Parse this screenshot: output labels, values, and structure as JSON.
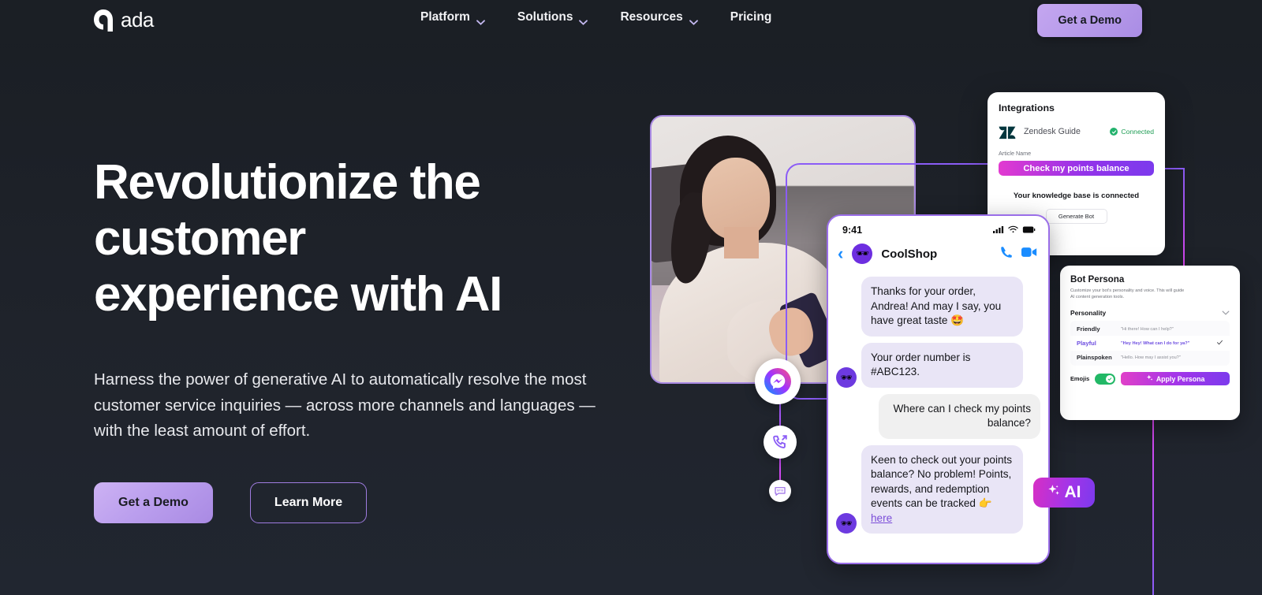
{
  "brand": {
    "name": "ada",
    "logo_icon": "ada-logo-mark"
  },
  "nav": {
    "items": [
      {
        "label": "Platform",
        "icon": "chevron-down-icon",
        "has_dropdown": true
      },
      {
        "label": "Solutions",
        "icon": "chevron-down-icon",
        "has_dropdown": true
      },
      {
        "label": "Resources",
        "icon": "chevron-down-icon",
        "has_dropdown": true
      },
      {
        "label": "Pricing",
        "icon": "",
        "has_dropdown": false
      }
    ],
    "cta_label": "Get a Demo"
  },
  "hero": {
    "headline_line1": "Revolutionize the",
    "headline_line2": "customer",
    "headline_line3": "experience with AI",
    "subcopy": "Harness the power of generative AI to automatically resolve the most customer service inquiries — across more channels and languages — with the least amount of effort.",
    "primary_cta": "Get a Demo",
    "secondary_cta": "Learn More"
  },
  "integrations_card": {
    "title": "Integrations",
    "provider": "Zendesk Guide",
    "provider_icon": "zendesk-logo-icon",
    "status": "Connected",
    "status_icon": "check-circle-icon",
    "field_label": "Article Name",
    "article_value": "Check my points balance",
    "knowledge_base_text": "Your knowledge base is connected",
    "generate_button": "Generate Bot"
  },
  "phone": {
    "status_time": "9:41",
    "status_icons": [
      "cellular-signal-icon",
      "wifi-icon",
      "battery-icon"
    ],
    "back_icon": "chevron-left-icon",
    "contact_name": "CoolShop",
    "contact_avatar_emoji": "🕶",
    "call_icon": "phone-icon",
    "video_icon": "video-camera-icon",
    "messages": [
      {
        "from": "bot",
        "text": "Thanks for your order, Andrea! And may I say, you have great taste 🤩",
        "avatar": false
      },
      {
        "from": "bot",
        "text": "Your order number is #ABC123.",
        "avatar": true
      },
      {
        "from": "user",
        "text": "Where can I check my points balance?",
        "avatar": false
      },
      {
        "from": "bot",
        "text": "Keen to check out your points balance? No problem! Points, rewards, and redemption events can be tracked 👉 ",
        "link_text": "here",
        "avatar": true
      }
    ]
  },
  "persona_card": {
    "title": "Bot Persona",
    "description": "Customize your bot's personality and voice. This will guide AI content generation tools.",
    "section_label": "Personality",
    "section_icon": "chevron-down-icon",
    "options": [
      {
        "label": "Friendly",
        "example": "\"Hi there! How can I help?\"",
        "selected": false
      },
      {
        "label": "Playful",
        "example": "\"Hey Hey! What can I do for ya?\"",
        "selected": true
      },
      {
        "label": "Plainspoken",
        "example": "\"Hello. How may I assist you?\"",
        "selected": false
      }
    ],
    "emoji_label": "Emojis",
    "emoji_enabled": true,
    "apply_button": "Apply Persona",
    "apply_icon": "sparkle-icon"
  },
  "channels": [
    {
      "name": "messenger-icon"
    },
    {
      "name": "voice-call-icon"
    },
    {
      "name": "sms-icon"
    }
  ],
  "ai_badge": {
    "label": "AI",
    "icon": "sparkle-icon"
  },
  "colors": {
    "background": "#1c2026",
    "accent_purple": "#a98ae3",
    "gradient_start": "#e23ad0",
    "gradient_end": "#7c3aed",
    "connected_green": "#23b26d",
    "link_blue": "#1a8cff"
  }
}
